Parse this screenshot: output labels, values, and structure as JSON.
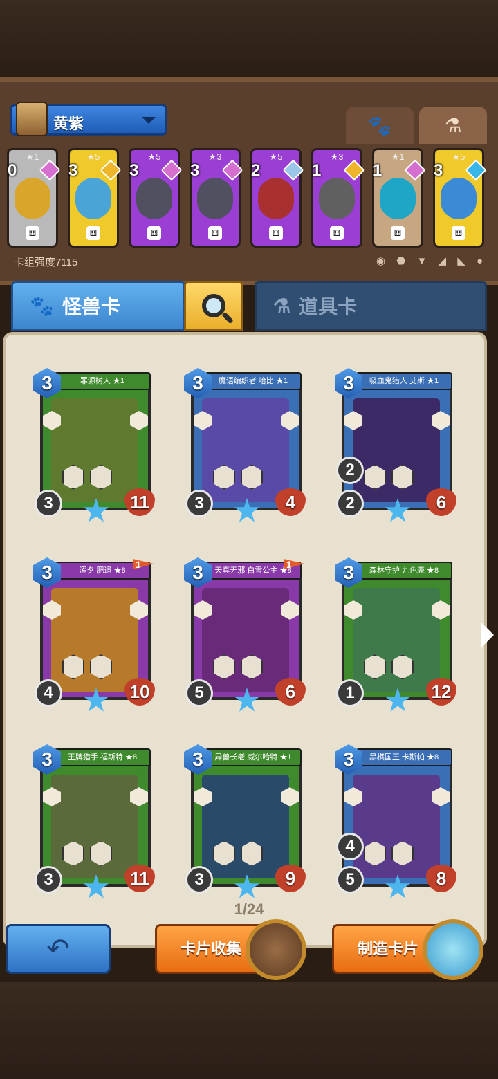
{
  "deck": {
    "name": "黄紫",
    "power_label": "卡组强度7115",
    "cards": [
      {
        "cost": "0",
        "stars": "★1",
        "frame": "#b9b9b9",
        "art": "#d9a52a",
        "gem": "#d56fd0"
      },
      {
        "cost": "3",
        "stars": "★5",
        "frame": "#f0c92b",
        "art": "#4aa4d6",
        "gem": "#f0b62b"
      },
      {
        "cost": "3",
        "stars": "★5",
        "frame": "#9b3fd4",
        "art": "#505060",
        "gem": "#d56fd0"
      },
      {
        "cost": "3",
        "stars": "★3",
        "frame": "#9b3fd4",
        "art": "#505060",
        "gem": "#d56fd0"
      },
      {
        "cost": "2",
        "stars": "★5",
        "frame": "#9b3fd4",
        "art": "#a83030",
        "gem": "#9cc6e8"
      },
      {
        "cost": "1",
        "stars": "★3",
        "frame": "#9b3fd4",
        "art": "#606060",
        "gem": "#f0b62b"
      },
      {
        "cost": "1",
        "stars": "★1",
        "frame": "#c7a782",
        "art": "#1fa6c6",
        "gem": "#d56fd0"
      },
      {
        "cost": "3",
        "stars": "★5",
        "frame": "#f0c92b",
        "art": "#3a8ad6",
        "gem": "#38b6e8"
      }
    ],
    "filter_icons": "◉ ⬣ ▼ ◢ ◣ ●"
  },
  "tabs": {
    "monster": "怪兽卡",
    "item": "道具卡",
    "paw": "🐾",
    "potion": "⚗"
  },
  "cards": [
    {
      "name": "罪源树人 ★1",
      "cost": "3",
      "atk": "3",
      "hp": "11",
      "color": "#3f8a2c",
      "art": "#5f7a2e",
      "flag": ""
    },
    {
      "name": "魔语编织者 哈比 ★1",
      "cost": "3",
      "atk": "3",
      "hp": "4",
      "color": "#3a6fb6",
      "art": "#5a4aa8",
      "flag": ""
    },
    {
      "name": "吸血鬼猎人 艾斯 ★1",
      "cost": "3",
      "atk": "2",
      "atk2": "2",
      "hp": "6",
      "color": "#3a6fb6",
      "art": "#3b2a66",
      "flag": ""
    },
    {
      "name": "浑夕 肥遗 ★8",
      "cost": "3",
      "atk": "4",
      "hp": "10",
      "color": "#8a3aa8",
      "art": "#b77a2a",
      "flag": "1"
    },
    {
      "name": "天真无邪 白雪公主 ★8",
      "cost": "3",
      "atk": "5",
      "hp": "6",
      "color": "#8a3aa8",
      "art": "#6a2a7a",
      "flag": "1"
    },
    {
      "name": "森林守护 九色鹿 ★8",
      "cost": "3",
      "atk": "1",
      "hp": "12",
      "color": "#3f8a2c",
      "art": "#3f7a4a",
      "flag": ""
    },
    {
      "name": "王牌猎手 福斯特 ★8",
      "cost": "3",
      "atk": "3",
      "hp": "11",
      "color": "#3f8a2c",
      "art": "#5a6a3a",
      "flag": ""
    },
    {
      "name": "异兽长老 威尔哈特 ★1",
      "cost": "3",
      "atk": "3",
      "hp": "9",
      "color": "#3f8a2c",
      "art": "#2a4a6a",
      "flag": ""
    },
    {
      "name": "黑棋国王 卡斯帕 ★8",
      "cost": "3",
      "atk": "5",
      "atk2": "4",
      "hp": "8",
      "color": "#3a6fb6",
      "art": "#5a3a8a",
      "flag": ""
    }
  ],
  "page": "1/24",
  "buttons": {
    "back": "↶",
    "collect": "卡片收集",
    "craft": "制造卡片"
  }
}
